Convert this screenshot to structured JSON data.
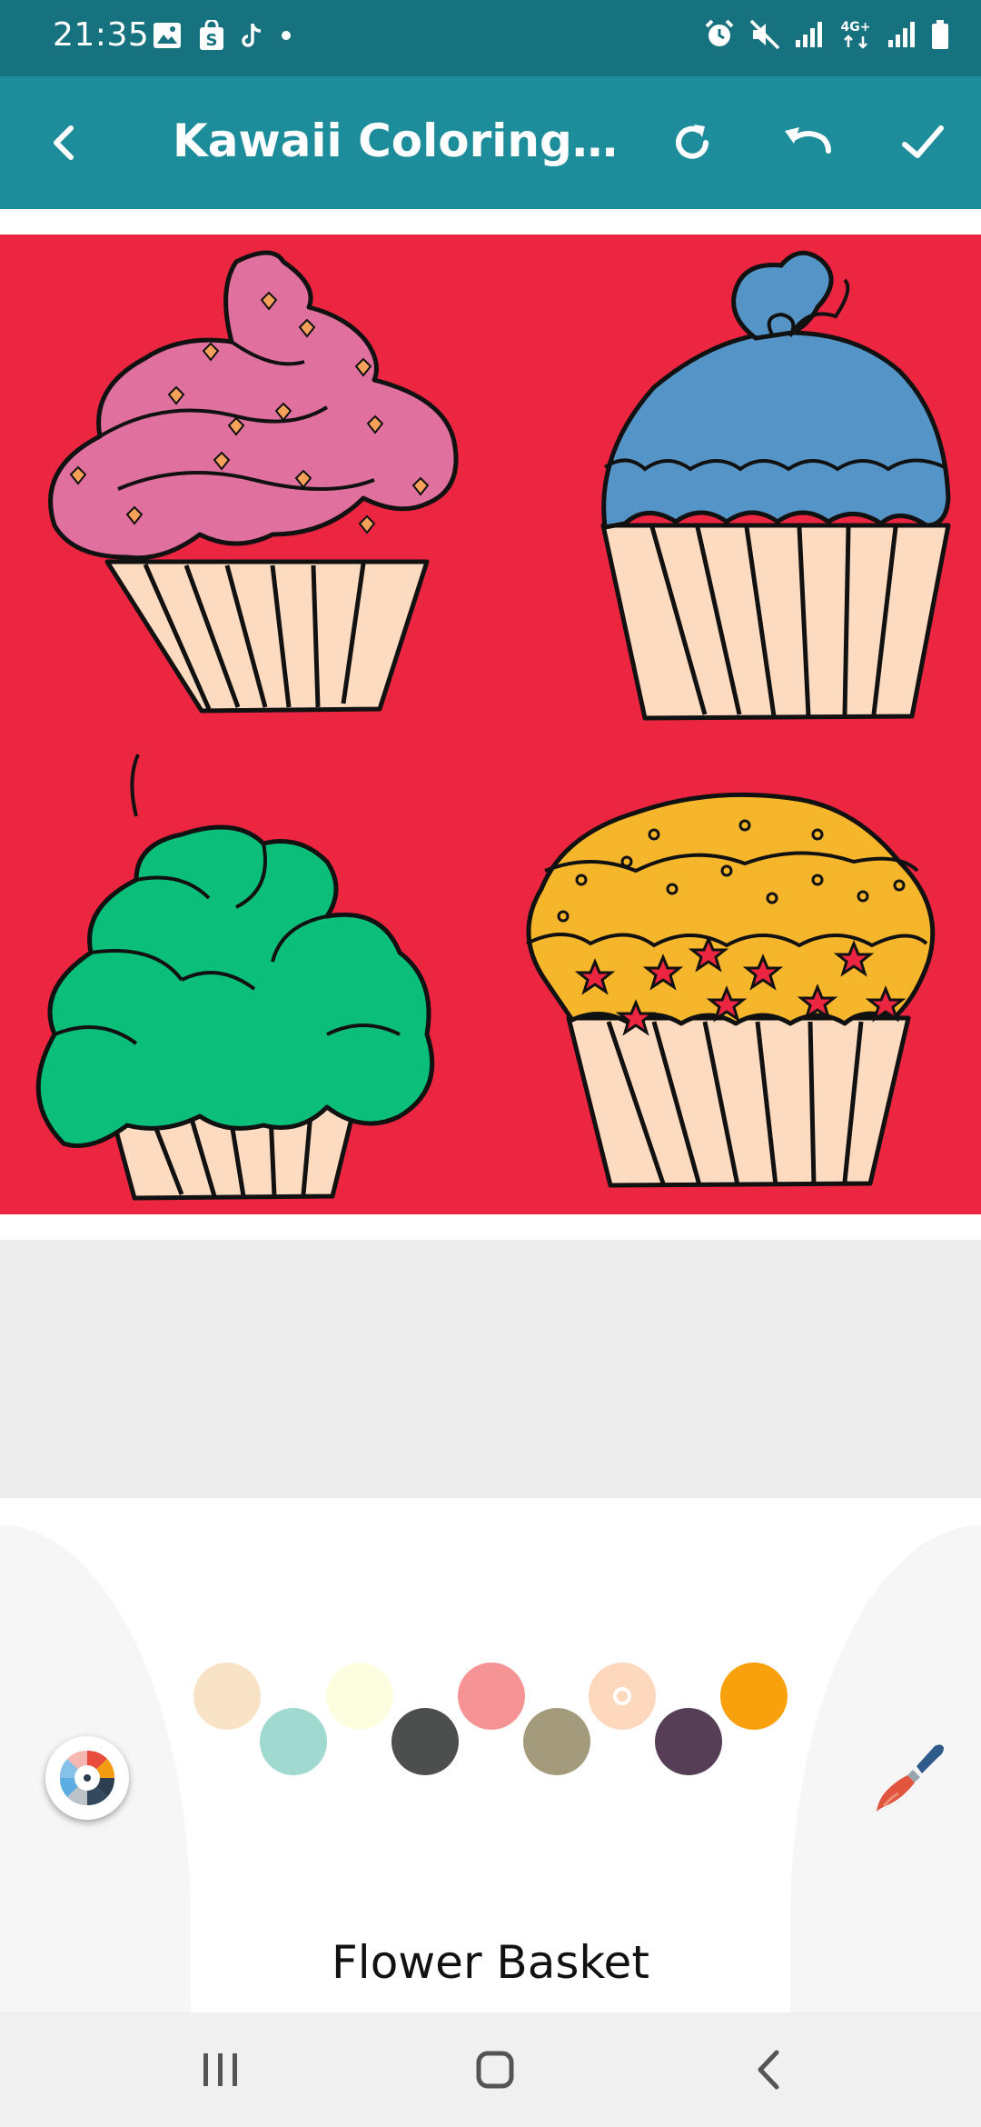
{
  "status_bar": {
    "time": "21:35",
    "left_icons": [
      "image-icon",
      "shopping-bag-icon",
      "tiktok-icon",
      "dot-icon"
    ],
    "right_icons": [
      "alarm-icon",
      "mute-icon",
      "signal-icon",
      "network-4g-icon",
      "signal-icon",
      "battery-icon"
    ],
    "network_label": "4G+"
  },
  "app_bar": {
    "title": "Kawaii Coloring Cu...",
    "icons": [
      "back-arrow-icon",
      "refresh-icon",
      "undo-icon",
      "check-icon"
    ],
    "color": "#1d8c9b"
  },
  "canvas": {
    "background_color": "#ec2540",
    "cupcakes": [
      {
        "name": "pink-swirl-cupcake",
        "frosting_color": "#e0719f"
      },
      {
        "name": "blue-heart-cupcake",
        "frosting_color": "#5594c7"
      },
      {
        "name": "green-cloud-cupcake",
        "frosting_color": "#0bbf7a"
      },
      {
        "name": "yellow-star-cupcake",
        "frosting_color": "#f6b62b"
      }
    ],
    "wrapper_color": "#fddbc0"
  },
  "palette": {
    "colors": [
      "#f9e3c6",
      "#9fd9cf",
      "#fdfde0",
      "#4d4f4e",
      "#f69394",
      "#a49a7c",
      "#fdd8bd",
      "#563f56",
      "#f8a10c"
    ],
    "selected_index": 6
  },
  "tools": {
    "palette_button_icon": "color-wheel-icon",
    "brush_button_icon": "paintbrush-icon"
  },
  "pack_name": "Flower Basket",
  "nav_bar": {
    "icons": [
      "recent-apps-icon",
      "home-icon",
      "back-icon"
    ]
  }
}
